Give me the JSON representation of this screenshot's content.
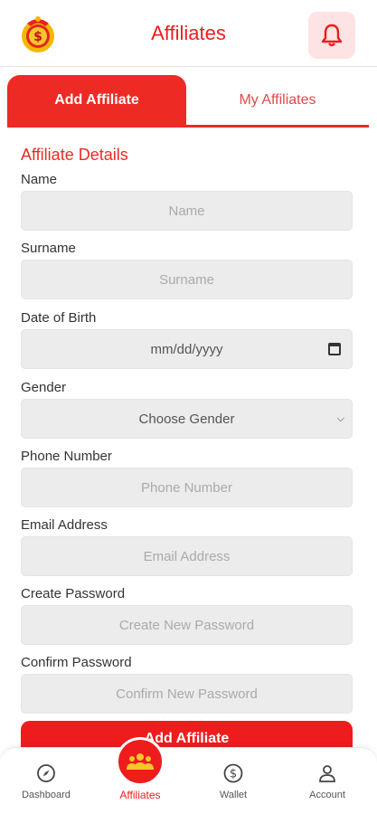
{
  "header": {
    "title": "Affiliates",
    "logo_icon": "coin-logo-icon",
    "notification_icon": "bell-icon"
  },
  "tabs": [
    {
      "label": "Add Affiliate",
      "active": true
    },
    {
      "label": "My Affiliates",
      "active": false
    }
  ],
  "form": {
    "section_title": "Affiliate Details",
    "fields": [
      {
        "label": "Name",
        "placeholder": "Name"
      },
      {
        "label": "Surname",
        "placeholder": "Surname"
      },
      {
        "label": "Date of Birth",
        "placeholder": "mm/dd/yyyy"
      },
      {
        "label": "Gender",
        "placeholder": "Choose Gender"
      },
      {
        "label": "Phone Number",
        "placeholder": "Phone Number"
      },
      {
        "label": "Email Address",
        "placeholder": "Email Address"
      },
      {
        "label": "Create Password",
        "placeholder": "Create New Password"
      },
      {
        "label": "Confirm Password",
        "placeholder": "Confirm New Password"
      }
    ],
    "submit_label": "Add Affiliate"
  },
  "nav": [
    {
      "label": "Dashboard",
      "icon": "compass-icon"
    },
    {
      "label": "Affiliates",
      "icon": "users-icon",
      "active": true
    },
    {
      "label": "Wallet",
      "icon": "dollar-icon"
    },
    {
      "label": "Account",
      "icon": "user-icon"
    }
  ],
  "colors": {
    "brand": "#ee1c1c",
    "field_bg": "#ececec",
    "bell_bg": "#fde3e3"
  }
}
